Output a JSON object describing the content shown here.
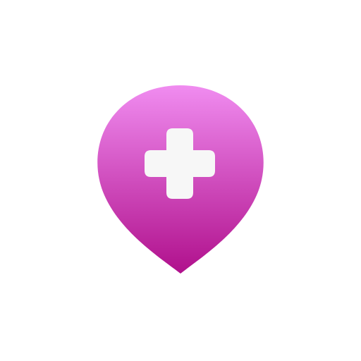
{
  "icon": {
    "name": "location-pin-plus-icon",
    "glyph": "map-pin-with-medical-cross",
    "colors": {
      "background": "#ffffff",
      "pin_gradient_top": "#f08cf0",
      "pin_gradient_bottom": "#b0108c",
      "cross": "#f7f7f7"
    }
  }
}
